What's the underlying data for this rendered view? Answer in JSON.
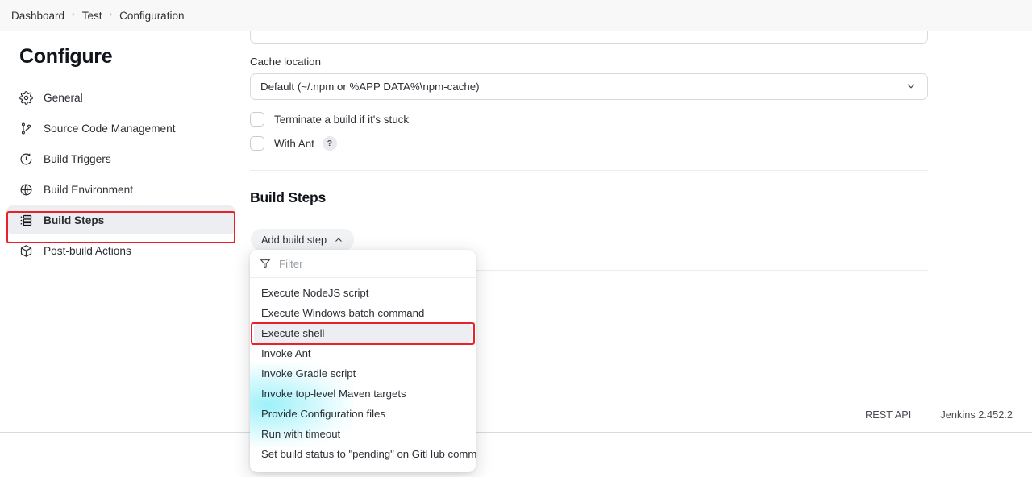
{
  "breadcrumb": {
    "items": [
      "Dashboard",
      "Test",
      "Configuration"
    ],
    "separator": "›"
  },
  "sidebar": {
    "title": "Configure",
    "items": [
      {
        "label": "General",
        "icon": "gear-icon",
        "active": false
      },
      {
        "label": "Source Code Management",
        "icon": "git-branch-icon",
        "active": false
      },
      {
        "label": "Build Triggers",
        "icon": "clock-icon",
        "active": false
      },
      {
        "label": "Build Environment",
        "icon": "globe-icon",
        "active": false
      },
      {
        "label": "Build Steps",
        "icon": "list-icon",
        "active": true
      },
      {
        "label": "Post-build Actions",
        "icon": "package-icon",
        "active": false
      }
    ]
  },
  "main": {
    "cache": {
      "label": "Cache location",
      "value": "Default (~/.npm or %APP DATA%\\npm-cache)"
    },
    "checkboxes": [
      {
        "label": "Terminate a build if it's stuck",
        "checked": false,
        "help": false
      },
      {
        "label": "With Ant",
        "checked": false,
        "help": true,
        "help_glyph": "?"
      }
    ],
    "build_steps": {
      "heading": "Build Steps",
      "add_button": "Add build step"
    },
    "dropdown": {
      "filter_placeholder": "Filter",
      "items": [
        {
          "label": "Execute NodeJS script",
          "hovered": false
        },
        {
          "label": "Execute Windows batch command",
          "hovered": false
        },
        {
          "label": "Execute shell",
          "hovered": true
        },
        {
          "label": "Invoke Ant",
          "hovered": false
        },
        {
          "label": "Invoke Gradle script",
          "hovered": false
        },
        {
          "label": "Invoke top-level Maven targets",
          "hovered": false
        },
        {
          "label": "Provide Configuration files",
          "hovered": false
        },
        {
          "label": "Run with timeout",
          "hovered": false
        },
        {
          "label": "Set build status to \"pending\" on GitHub commit",
          "hovered": false
        }
      ]
    }
  },
  "footer": {
    "rest_api": "REST API",
    "version": "Jenkins 2.452.2"
  },
  "colors": {
    "annotation": "#e8212a",
    "active_nav_bg": "#eceef1",
    "glow": "#78ebf7"
  }
}
